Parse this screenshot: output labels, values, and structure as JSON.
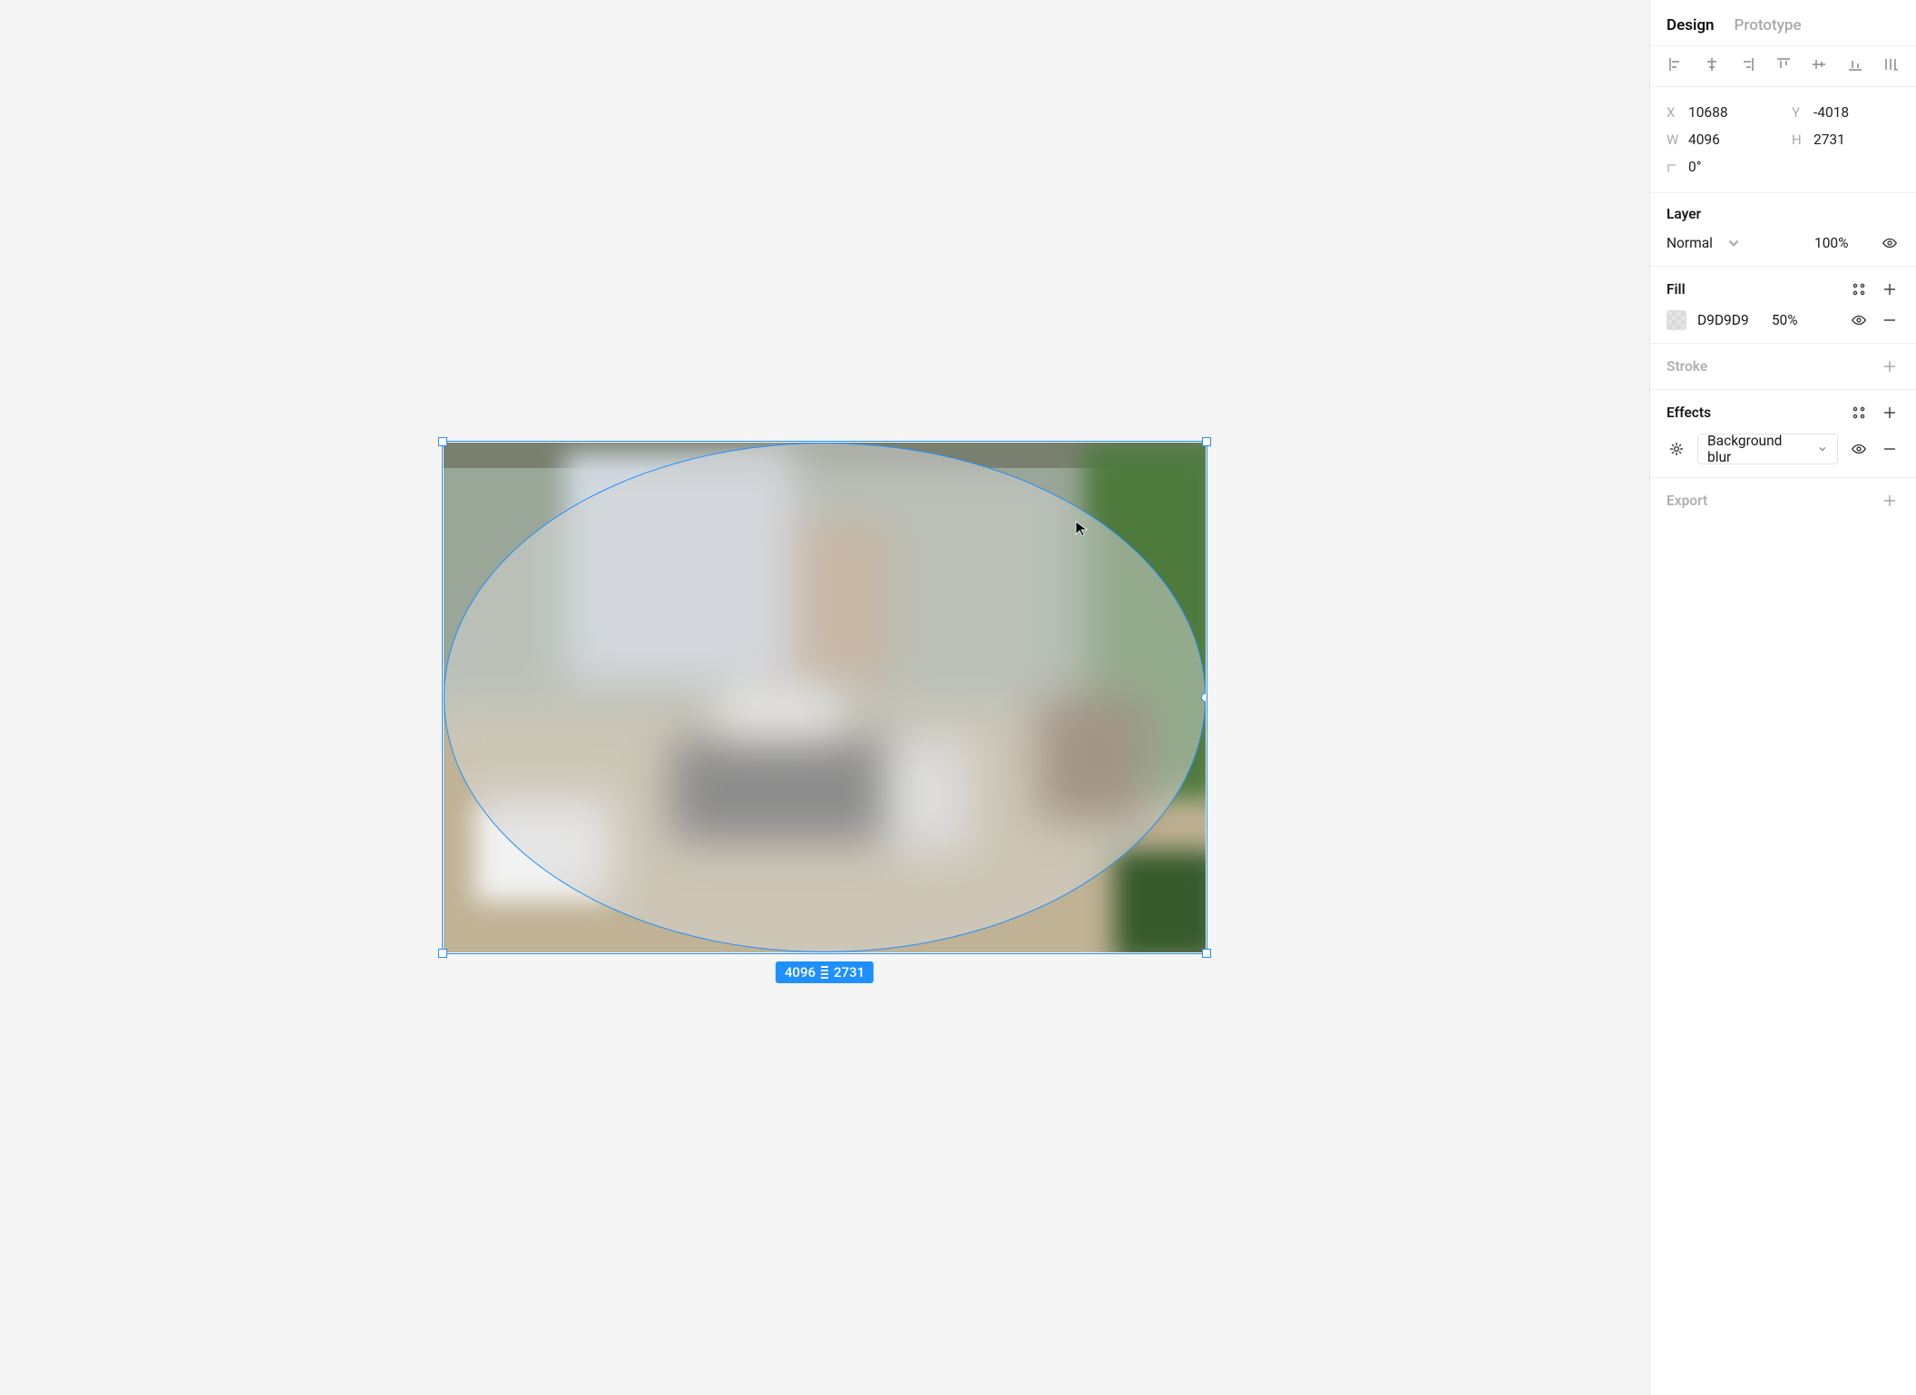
{
  "tabs": {
    "design": "Design",
    "prototype": "Prototype"
  },
  "geometry": {
    "x_label": "X",
    "x": "10688",
    "y_label": "Y",
    "y": "-4018",
    "w_label": "W",
    "w": "4096",
    "h_label": "H",
    "h": "2731",
    "rotation_label": "",
    "rotation": "0°"
  },
  "badge": {
    "w": "4096",
    "h": "2731"
  },
  "layer": {
    "title": "Layer",
    "blend": "Normal",
    "opacity": "100%"
  },
  "fill": {
    "title": "Fill",
    "hex": "D9D9D9",
    "opacity": "50%"
  },
  "stroke": {
    "title": "Stroke"
  },
  "effects": {
    "title": "Effects",
    "selected": "Background blur"
  },
  "export": {
    "title": "Export"
  }
}
